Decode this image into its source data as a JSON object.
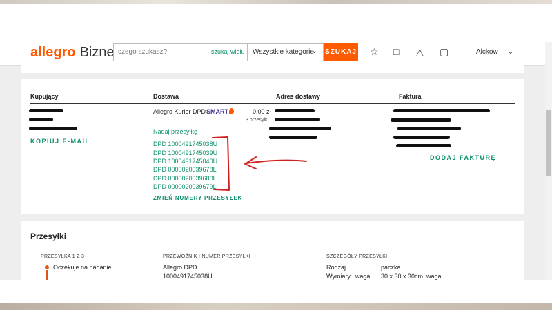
{
  "header": {
    "logo_brand": "allegro",
    "logo_suffix": "Biznes",
    "search_placeholder": "czego szukasz?",
    "search_more": "szukaj wielu",
    "category": "Wszystkie kategorie",
    "search_button": "SZUKAJ",
    "account": "Alckow",
    "icons": [
      "star-icon",
      "chat-icon",
      "bell-icon",
      "cart-icon"
    ]
  },
  "order": {
    "col_buyer": "Kupujący",
    "col_delivery": "Dostawa",
    "col_address": "Adres dostawy",
    "col_invoice": "Faktura",
    "carrier": "Allegro Kurier DPD",
    "smart": "SMART",
    "price": "0,00 zł",
    "parcels_count": "3 przesyłki",
    "copy_email": "KOPIUJ E-MAIL",
    "send_parcel": "Nadaj przesyłkę",
    "tracking": [
      "DPD 1000491745038U",
      "DPD 1000491745039U",
      "DPD 1000491745040U",
      "DPD 0000020039678L",
      "DPD 0000020039680L",
      "DPD 0000020039679L"
    ],
    "change_numbers": "ZMIEŃ NUMERY PRZESYŁEK",
    "add_invoice": "DODAJ FAKTURĘ"
  },
  "shipments": {
    "title": "Przesyłki",
    "parcel_label": "PRZESYŁKA 1 Z 3",
    "status": "Oczekuje na nadanie",
    "carrier_label": "PRZEWOŹNIK I NUMER PRZESYŁKI",
    "carrier_name": "Allegro DPD",
    "carrier_number": "1000491745038U",
    "details_label": "SZCZEGÓŁY PRZESYŁKI",
    "type_key": "Rodzaj",
    "type_value": "paczka",
    "dims_key": "Wymiary i waga",
    "dims_value": "30 x 30 x 30cm, waga"
  },
  "colors": {
    "accent": "#ff5a00",
    "link": "#0a8f6a",
    "annotation": "#d21f1f"
  }
}
